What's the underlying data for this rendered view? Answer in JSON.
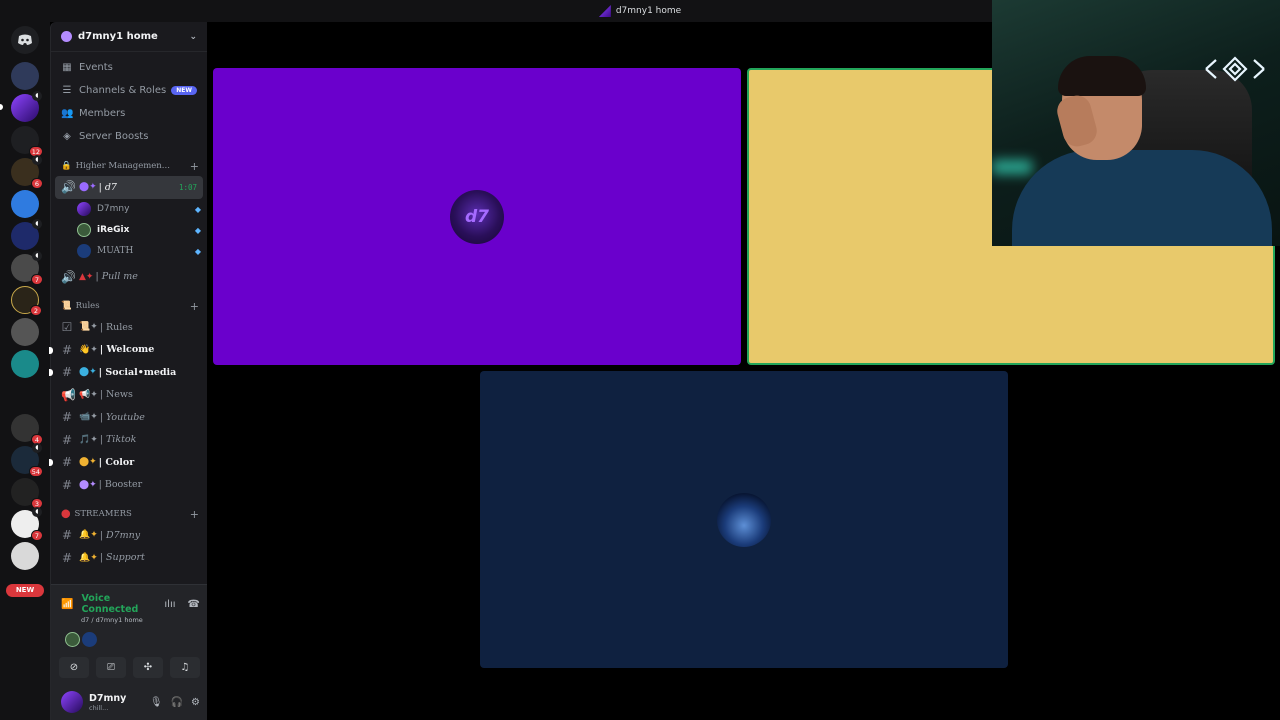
{
  "window": {
    "title": "d7mny1 home"
  },
  "guild": {
    "name": "d7mny1 home"
  },
  "rail": {
    "badges": [
      "12",
      "6",
      "7",
      "2",
      "4",
      "54",
      "3",
      "7"
    ],
    "new_label": "NEW"
  },
  "nav": {
    "events": "Events",
    "channels_roles": "Channels & Roles",
    "channels_new": "NEW",
    "members": "Members",
    "boosts": "Server Boosts"
  },
  "categories": {
    "higher": "Higher Managemen...",
    "rules": "Rules",
    "streamers": "STREAMERS"
  },
  "voice_channel": {
    "name": "| d7",
    "timer": "1:07",
    "users": [
      "D7mny",
      "iReGix",
      "MUATH"
    ]
  },
  "pull_channel": "| Pull me",
  "rules_channels": [
    "| Rules",
    "| Welcome",
    "| Social•media",
    "| News",
    "| Youtube",
    "| Tiktok",
    "| Color",
    "| Booster"
  ],
  "streamer_channels": [
    "| D7mny",
    "| Support"
  ],
  "voice_panel": {
    "status": "Voice Connected",
    "location": "d7 / d7mny1 home"
  },
  "current_user": {
    "name": "D7mny",
    "status": "chill..."
  },
  "colors": {
    "tile1": "#6a00cc",
    "tile2": "#e8c96b",
    "tile3": "#0f2140",
    "accent_green": "#23a55a"
  }
}
